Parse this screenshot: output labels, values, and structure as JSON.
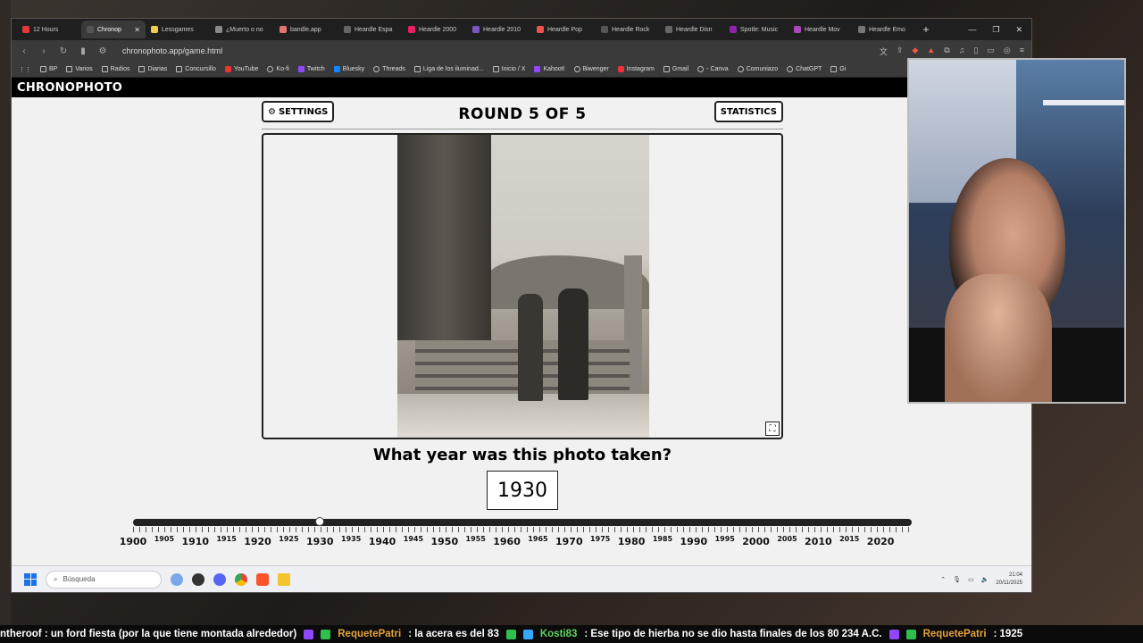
{
  "browser": {
    "tabs": [
      {
        "label": "12 Hours",
        "color": "#e53935"
      },
      {
        "label": "Chronop",
        "color": "#555555",
        "active": true
      },
      {
        "label": "Lessgames",
        "color": "#f2c94c"
      },
      {
        "label": "¿Muerto o no",
        "color": "#888888"
      },
      {
        "label": "bandle.app",
        "color": "#e57373"
      },
      {
        "label": "Heardle Espa",
        "color": "#666666"
      },
      {
        "label": "Heardle 2000",
        "color": "#e91e63"
      },
      {
        "label": "Heardle 2010",
        "color": "#7e57c2"
      },
      {
        "label": "Heardle Pop",
        "color": "#ef5350"
      },
      {
        "label": "Heardle Rock",
        "color": "#555555"
      },
      {
        "label": "Heardle Disn",
        "color": "#666666"
      },
      {
        "label": "Spotle: Music",
        "color": "#8e24aa"
      },
      {
        "label": "Heardle Mov",
        "color": "#ab47bc"
      },
      {
        "label": "Heardle Emo",
        "color": "#777777"
      }
    ],
    "url": "chronophoto.app/game.html",
    "bookmarks": [
      {
        "label": "BP",
        "icon": "folder"
      },
      {
        "label": "Varios",
        "icon": "folder"
      },
      {
        "label": "Radios",
        "icon": "folder"
      },
      {
        "label": "Diarias",
        "icon": "folder"
      },
      {
        "label": "Concursillo",
        "icon": "folder"
      },
      {
        "label": "YouTube",
        "icon": "red"
      },
      {
        "label": "Ko-fi",
        "icon": "round"
      },
      {
        "label": "Twitch",
        "icon": "purple"
      },
      {
        "label": "Bluesky",
        "icon": "blue"
      },
      {
        "label": "Threads",
        "icon": "round"
      },
      {
        "label": "Liga de los iluminad...",
        "icon": "folder"
      },
      {
        "label": "Inicio / X",
        "icon": "folder"
      },
      {
        "label": "Kahoot!",
        "icon": "purple"
      },
      {
        "label": "Biwenger",
        "icon": "round"
      },
      {
        "label": "Instagram",
        "icon": "red"
      },
      {
        "label": "Gmail",
        "icon": "folder"
      },
      {
        "label": "- Canva",
        "icon": "round"
      },
      {
        "label": "Comuniazo",
        "icon": "round"
      },
      {
        "label": "ChatGPT",
        "icon": "round"
      },
      {
        "label": "Gi",
        "icon": "folder"
      }
    ]
  },
  "site": {
    "logo": "CHRONOPHOTO",
    "settings_label": "SETTINGS",
    "statistics_label": "STATISTICS",
    "round_title": "ROUND 5 OF 5",
    "question": "What year was this photo taken?",
    "selected_year": "1930",
    "slider": {
      "min": 1900,
      "max": 2025,
      "value": 1930
    }
  },
  "timeline": {
    "major": [
      "1900",
      "1910",
      "1920",
      "1930",
      "1940",
      "1950",
      "1960",
      "1970",
      "1980",
      "1990",
      "2000",
      "2010",
      "2020"
    ],
    "minor": [
      "1905",
      "1915",
      "1925",
      "1935",
      "1945",
      "1955",
      "1965",
      "1975",
      "1985",
      "1995",
      "2005",
      "2015"
    ]
  },
  "taskbar": {
    "search_placeholder": "Búsqueda",
    "time": "21:04",
    "date": "20/11/2025"
  },
  "ticker": [
    {
      "user": "",
      "msg": "ntheroof :  un ford fiesta (por la que tiene montada alrededor)"
    },
    {
      "user": "RequetePatri",
      "msg": ":  la acera es del 83"
    },
    {
      "user": "Kosti83",
      "msg": ":  Ese tipo de hierba no se dio hasta finales de los 80  234 A.C.",
      "green": true
    },
    {
      "user": "RequetePatri",
      "msg": ":  1925"
    }
  ]
}
